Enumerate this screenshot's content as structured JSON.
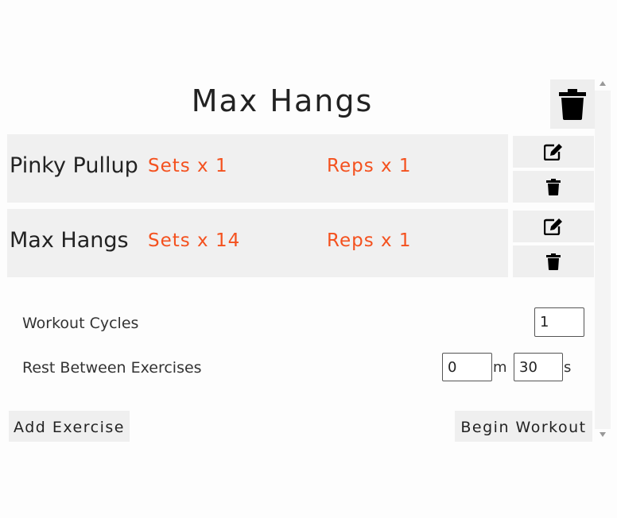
{
  "workout": {
    "title": "Max Hangs",
    "delete_icon": "trash-icon"
  },
  "exercises": [
    {
      "name": "Pinky Pullup",
      "sets": "Sets x 1",
      "reps": "Reps x 1"
    },
    {
      "name": "Max Hangs",
      "sets": "Sets x 14",
      "reps": "Reps x 1"
    }
  ],
  "icons": {
    "edit": "edit-icon",
    "delete": "trash-icon"
  },
  "settings": {
    "cycles_label": "Workout Cycles",
    "cycles_value": "1",
    "rest_label": "Rest Between Exercises",
    "rest_minutes": "0",
    "rest_minutes_unit": "m",
    "rest_seconds": "30",
    "rest_seconds_unit": "s"
  },
  "actions": {
    "add_exercise": "Add Exercise",
    "begin_workout": "Begin Workout"
  },
  "colors": {
    "accent": "#f4511e",
    "row_background": "#f0f0f0"
  }
}
